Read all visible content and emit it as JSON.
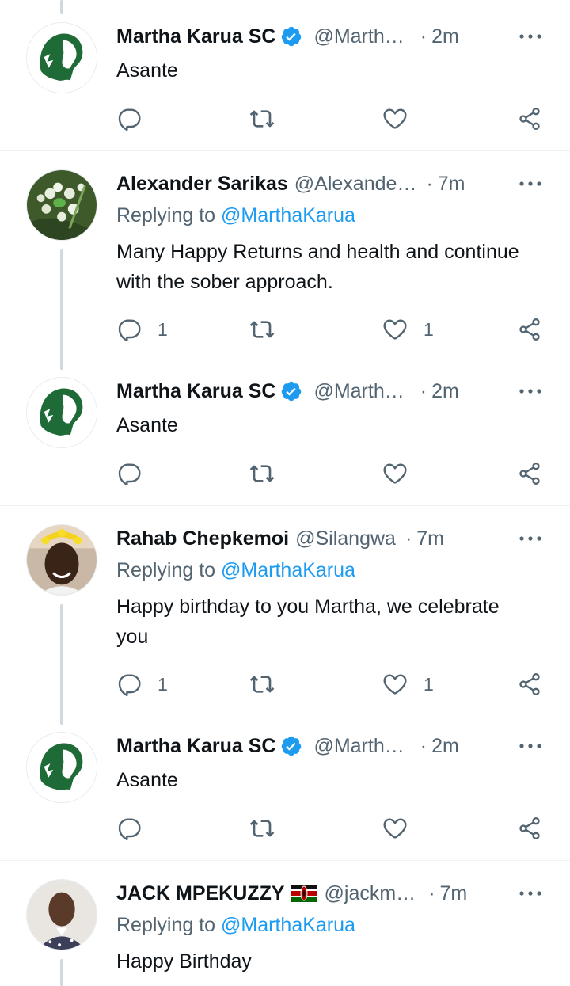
{
  "colors": {
    "accent": "#1d9bf0",
    "muted": "#536471",
    "text": "#0f1419",
    "thread": "#cfd9de",
    "divider": "#eff3f4"
  },
  "more_icon": "more-horizontal-icon",
  "tweets": [
    {
      "name": "Martha Karua SC",
      "handle": "@Marth…",
      "time": "2m",
      "verified": true,
      "text": "Asante",
      "replies": "",
      "likes": ""
    },
    {
      "name": "Alexander Sarikas",
      "handle": "@Alexande…",
      "time": "7m",
      "replying_label": "Replying to",
      "replying_to": "@MarthaKarua",
      "text": "Many Happy Returns and health and continue with the sober approach.",
      "replies": "1",
      "likes": "1"
    },
    {
      "name": "Martha Karua SC",
      "handle": "@Marth…",
      "time": "2m",
      "verified": true,
      "text": "Asante",
      "replies": "",
      "likes": ""
    },
    {
      "name": "Rahab Chepkemoi",
      "handle": "@Silangwa",
      "time": "7m",
      "replying_label": "Replying to",
      "replying_to": "@MarthaKarua",
      "text": "Happy birthday to you Martha, we celebrate you",
      "replies": "1",
      "likes": "1"
    },
    {
      "name": "Martha Karua SC",
      "handle": "@Marth…",
      "time": "2m",
      "verified": true,
      "text": "Asante",
      "replies": "",
      "likes": ""
    },
    {
      "name": "JACK MPEKUZZY",
      "handle": "@jackm…",
      "time": "7m",
      "flag": "kenya-flag",
      "replying_label": "Replying to",
      "replying_to": "@MarthaKarua",
      "text": "Happy Birthday"
    }
  ]
}
